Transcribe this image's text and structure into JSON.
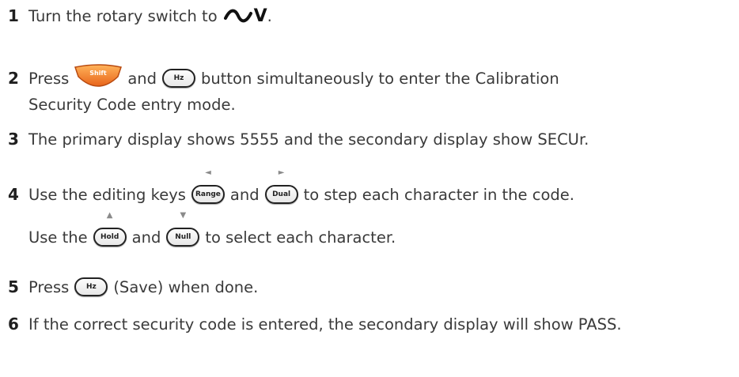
{
  "steps": [
    {
      "num": "1",
      "a": "Turn the rotary switch to",
      "b": "V",
      "c": "."
    },
    {
      "num": "2",
      "a": "Press",
      "b": "and",
      "c": "button simultaneously to enter the Calibration",
      "d": "Security Code entry mode."
    },
    {
      "num": "3",
      "a": "The primary display shows 5555 and the secondary display show SECUr."
    },
    {
      "num": "4",
      "a": "Use the editing keys",
      "b": "and",
      "c": "to step each character in the code.",
      "d": "Use the",
      "e": "and",
      "f": "to select each character."
    },
    {
      "num": "5",
      "a": "Press",
      "b": "(Save) when done."
    },
    {
      "num": "6",
      "a": "If the correct security code is entered, the secondary display will show PASS."
    }
  ],
  "keys": {
    "shift": "Shift",
    "hz": "Hz",
    "range": "Range",
    "dual": "Dual",
    "hold": "Hold",
    "null": "Null",
    "left_arrow": "◄",
    "right_arrow": "►",
    "up_arrow": "▲",
    "down_arrow": "▼"
  },
  "icons": {
    "ac_symbol": "tilde-wave-icon",
    "shift_color": "#f07a1e"
  }
}
